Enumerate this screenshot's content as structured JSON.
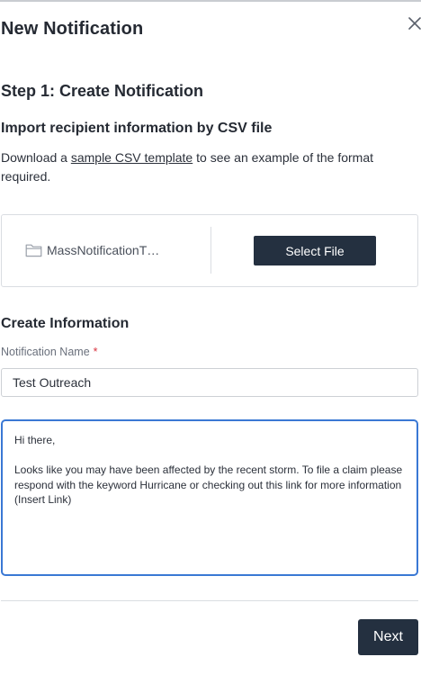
{
  "modal": {
    "title": "New Notification",
    "close_icon": "close-icon"
  },
  "step": {
    "title": "Step 1: Create Notification"
  },
  "import": {
    "title": "Import recipient information by CSV file",
    "download_prefix": "Download a ",
    "template_link": "sample CSV template",
    "download_suffix": " to see an example of the format required."
  },
  "upload": {
    "folder_icon": "folder-icon",
    "file_name": "MassNotificationT…",
    "select_button": "Select File"
  },
  "create": {
    "title": "Create Information",
    "name_label": "Notification Name",
    "required_marker": "*",
    "name_value": "Test Outreach",
    "message_value": "Hi there,\n\nLooks like you may have been affected by the recent storm. To file a claim please respond with the keyword Hurricane or checking out this link for more information (Insert Link)"
  },
  "footer": {
    "next_button": "Next"
  },
  "colors": {
    "primary_button": "#243040",
    "focus_border": "#3a78d4",
    "required": "#d9333f"
  }
}
